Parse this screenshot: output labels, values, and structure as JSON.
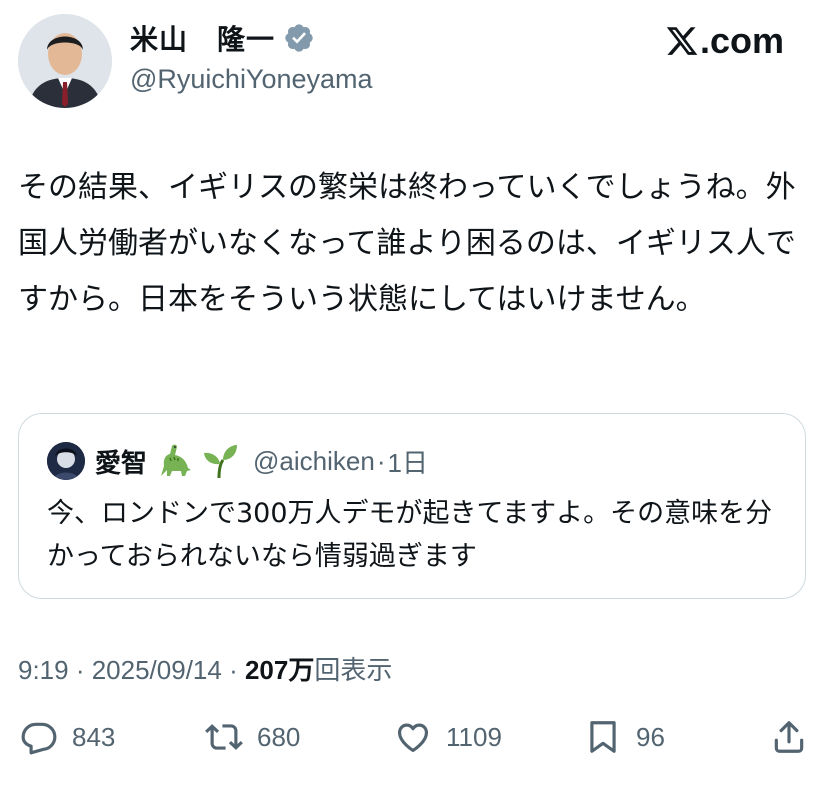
{
  "author": {
    "name": "米山　隆一",
    "handle": "@RyuichiYoneyama",
    "verified": true
  },
  "brand": {
    "label": ".com",
    "logo_icon": "x-logo-icon"
  },
  "tweet": {
    "text": "その結果、イギリスの繁栄は終わっていくでしょうね。外国人労働者がいなくなって誰より困るのは、イギリス人ですから。日本をそういう状態にしてはいけません。"
  },
  "quote": {
    "name": "愛智",
    "emojis": [
      "sauropod-dinosaur-icon",
      "seedling-icon"
    ],
    "handle": "@aichiken",
    "separator": "·",
    "time": "1日",
    "text": "今、ロンドンで300万人デモが起きてますよ。その意味を分かっておられないなら情弱過ぎます"
  },
  "meta": {
    "time": "9:19",
    "separator": " · ",
    "date": "2025/09/14",
    "views_count": "207万",
    "views_label": "回表示"
  },
  "actions": {
    "replies": "843",
    "reposts": "680",
    "likes": "1109",
    "bookmarks": "96"
  },
  "colors": {
    "text": "#0f1419",
    "secondary": "#536471",
    "border": "#cfd9de"
  }
}
